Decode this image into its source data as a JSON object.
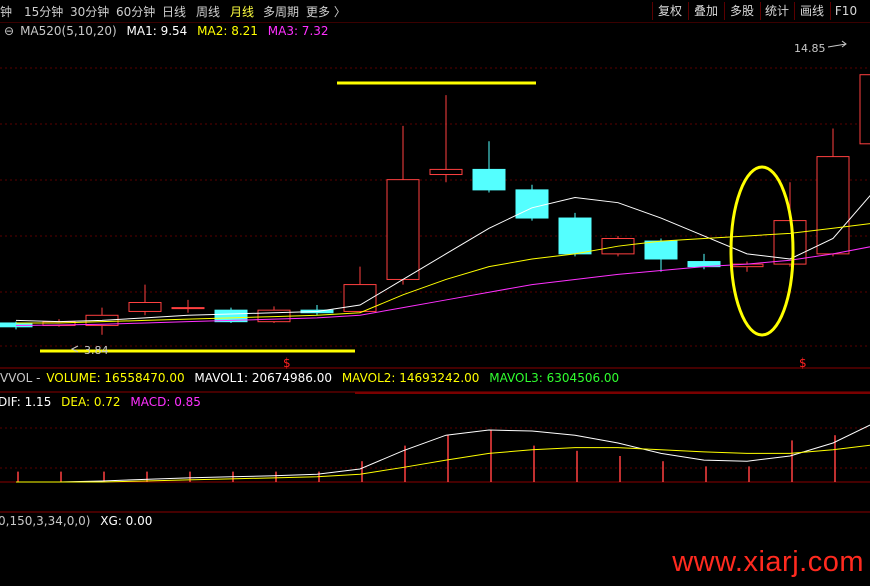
{
  "toolbar": {
    "periods": [
      "钟",
      "15分钟",
      "30分钟",
      "60分钟",
      "日线",
      "周线",
      "月线",
      "多周期",
      "更多 〉"
    ],
    "active_period": "月线",
    "right_buttons": [
      "复权",
      "叠加",
      "多股",
      "统计",
      "画线",
      "F10"
    ]
  },
  "ma_legend": {
    "name": "MA520(5,10,20)",
    "ma1": "MA1: 9.54",
    "ma2": "MA2: 8.21",
    "ma3": "MA3: 7.32"
  },
  "vol_legend": {
    "name": "VVOL -",
    "volume": "VOLUME: 16558470.00",
    "mavol1": "MAVOL1: 20674986.00",
    "mavol2": "MAVOL2: 14693242.00",
    "mavol3": "MAVOL3: 6304506.00"
  },
  "macd_legend": {
    "dif": "DIF: 1.15",
    "dea": "DEA: 0.72",
    "macd": "MACD: 0.85"
  },
  "xg_legend": {
    "params": "0,150,3,34,0,0)",
    "xg": "XG: 0.00"
  },
  "price_labels": {
    "high": "14.85",
    "low": "3.84"
  },
  "watermark": "www.xiarj.com",
  "colors": {
    "up": "#ff4040",
    "down": "#54ffff",
    "ma1": "#ffffff",
    "ma2": "#ffff00",
    "ma3": "#ff30ff",
    "highlight": "#ffff00"
  },
  "chart_data": {
    "type": "candlestick",
    "candles": [
      {
        "o": 4.3,
        "c": 4.15,
        "h": 4.35,
        "l": 4.05
      },
      {
        "o": 4.2,
        "c": 4.35,
        "h": 4.45,
        "l": 4.15
      },
      {
        "o": 4.2,
        "c": 4.6,
        "h": 4.9,
        "l": 3.84
      },
      {
        "o": 4.75,
        "c": 5.1,
        "h": 5.8,
        "l": 4.6
      },
      {
        "o": 4.9,
        "c": 4.9,
        "h": 5.2,
        "l": 4.7
      },
      {
        "o": 4.8,
        "c": 4.35,
        "h": 4.9,
        "l": 4.3
      },
      {
        "o": 4.35,
        "c": 4.8,
        "h": 4.95,
        "l": 4.3
      },
      {
        "o": 4.8,
        "c": 4.7,
        "h": 5.0,
        "l": 4.6
      },
      {
        "o": 4.75,
        "c": 5.8,
        "h": 6.5,
        "l": 4.7
      },
      {
        "o": 6.0,
        "c": 9.9,
        "h": 12.0,
        "l": 5.8
      },
      {
        "o": 10.1,
        "c": 10.3,
        "h": 13.2,
        "l": 9.8
      },
      {
        "o": 10.3,
        "c": 9.5,
        "h": 11.4,
        "l": 9.4
      },
      {
        "o": 9.5,
        "c": 8.4,
        "h": 9.7,
        "l": 8.3
      },
      {
        "o": 8.4,
        "c": 7.0,
        "h": 8.6,
        "l": 6.9
      },
      {
        "o": 7.0,
        "c": 7.6,
        "h": 7.7,
        "l": 6.9
      },
      {
        "o": 7.5,
        "c": 6.8,
        "h": 7.6,
        "l": 6.3
      },
      {
        "o": 6.7,
        "c": 6.5,
        "h": 7.0,
        "l": 6.4
      },
      {
        "o": 6.5,
        "c": 6.6,
        "h": 6.7,
        "l": 6.3
      },
      {
        "o": 6.6,
        "c": 8.3,
        "h": 9.8,
        "l": 6.5
      },
      {
        "o": 7.0,
        "c": 10.8,
        "h": 11.9,
        "l": 6.9
      },
      {
        "o": 11.3,
        "c": 14.0,
        "h": 14.85,
        "l": 10.4
      }
    ],
    "ma1": [
      4.4,
      4.35,
      4.4,
      4.5,
      4.6,
      4.65,
      4.7,
      4.75,
      5.0,
      6.0,
      7.0,
      8.0,
      8.8,
      9.2,
      9.0,
      8.4,
      7.7,
      7.0,
      6.8,
      7.6,
      9.54
    ],
    "ma2": [
      4.3,
      4.3,
      4.35,
      4.4,
      4.45,
      4.5,
      4.55,
      4.6,
      4.7,
      5.4,
      6.0,
      6.5,
      6.8,
      7.0,
      7.3,
      7.5,
      7.6,
      7.7,
      7.8,
      8.0,
      8.21
    ],
    "ma3": [
      4.2,
      4.22,
      4.25,
      4.3,
      4.35,
      4.4,
      4.45,
      4.5,
      4.6,
      4.9,
      5.2,
      5.5,
      5.8,
      6.0,
      6.2,
      6.35,
      6.5,
      6.6,
      6.75,
      7.0,
      7.32
    ],
    "volume_bars": [
      0.2,
      0.2,
      0.2,
      0.2,
      0.2,
      0.2,
      0.2,
      0.2,
      0.4,
      0.7,
      0.9,
      1.0,
      0.7,
      0.6,
      0.5,
      0.4,
      0.3,
      0.3,
      0.8,
      0.9,
      1.0
    ],
    "dif": [
      0.0,
      0.0,
      0.02,
      0.05,
      0.08,
      0.1,
      0.12,
      0.15,
      0.25,
      0.6,
      0.9,
      1.0,
      0.98,
      0.9,
      0.75,
      0.55,
      0.42,
      0.4,
      0.5,
      0.75,
      1.15
    ],
    "dea": [
      0.0,
      0.0,
      0.0,
      0.02,
      0.04,
      0.06,
      0.08,
      0.1,
      0.15,
      0.28,
      0.42,
      0.55,
      0.62,
      0.66,
      0.66,
      0.62,
      0.58,
      0.55,
      0.55,
      0.62,
      0.72
    ]
  }
}
